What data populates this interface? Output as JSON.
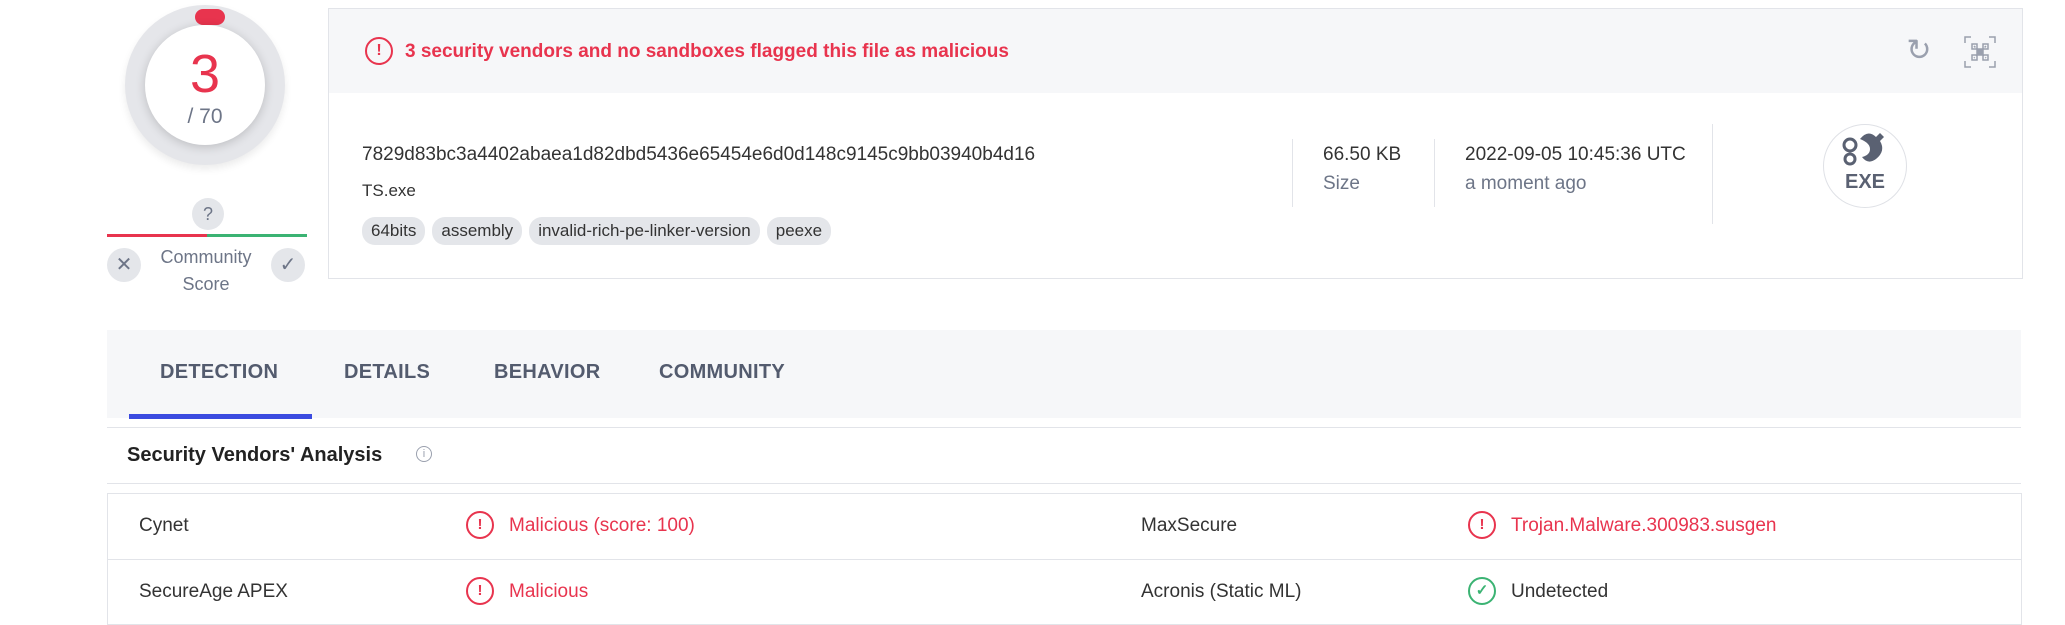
{
  "score": {
    "detections": "3",
    "total": "/ 70"
  },
  "community": {
    "question": "?",
    "label_line1": "Community",
    "label_line2": "Score",
    "down_icon": "✕",
    "up_icon": "✓"
  },
  "alert": {
    "text": "3 security vendors and no sandboxes flagged this file as malicious",
    "icon": "!"
  },
  "file": {
    "hash": "7829d83bc3a4402abaea1d82dbd5436e65454e6d0d148c9145c9bb03940b4d16",
    "name": "TS.exe",
    "tags": [
      "64bits",
      "assembly",
      "invalid-rich-pe-linker-version",
      "peexe"
    ],
    "size_value": "66.50 KB",
    "size_label": "Size",
    "date_value": "2022-09-05 10:45:36 UTC",
    "date_label": "a moment ago",
    "type_badge": "EXE"
  },
  "tabs": [
    "DETECTION",
    "DETAILS",
    "BEHAVIOR",
    "COMMUNITY"
  ],
  "section": {
    "title": "Security Vendors' Analysis",
    "info_icon": "i"
  },
  "vendors": [
    {
      "left_name": "Cynet",
      "left_result": "Malicious (score: 100)",
      "left_status": "malicious",
      "right_name": "MaxSecure",
      "right_result": "Trojan.Malware.300983.susgen",
      "right_status": "malicious"
    },
    {
      "left_name": "SecureAge APEX",
      "left_result": "Malicious",
      "left_status": "malicious",
      "right_name": "Acronis (Static ML)",
      "right_result": "Undetected",
      "right_status": "undetected"
    }
  ],
  "colors": {
    "malicious": "#e8344e",
    "clean": "#3bb373",
    "accent": "#3b4be0"
  }
}
